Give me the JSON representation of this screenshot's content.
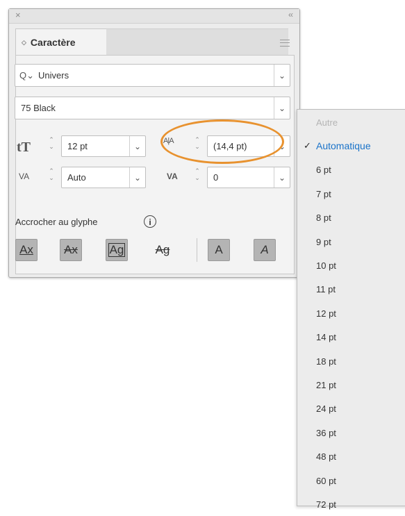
{
  "panel": {
    "close_glyph": "×",
    "collapse_glyph": "‹‹",
    "tab_label": "Caractère",
    "tab_chevron": "◇",
    "font_family": "Univers",
    "font_style": "75 Black",
    "font_size": "12 pt",
    "leading": "(14,4 pt)",
    "kerning": "Auto",
    "tracking": "0",
    "snap_label": "Accrocher au glyphe",
    "info_glyph": "i",
    "search_glyph": "Q⌄",
    "caret_glyph": "⌄"
  },
  "icons": {
    "font_size_icon": "tT",
    "leading_icon": "A|A",
    "kerning_icon": "VA",
    "tracking_icon": "VA"
  },
  "glyph_buttons": [
    {
      "label": "Ax",
      "active": true
    },
    {
      "label": "Ax",
      "active": true
    },
    {
      "label": "Ag",
      "active": true
    },
    {
      "label": "Ag",
      "active": false
    },
    {
      "label": "A",
      "active": true
    },
    {
      "label": "A",
      "active": true
    }
  ],
  "leading_menu": {
    "items": [
      {
        "label": "Autre",
        "state": "disabled"
      },
      {
        "label": "Automatique",
        "state": "selected"
      },
      {
        "label": "6 pt"
      },
      {
        "label": "7 pt"
      },
      {
        "label": "8 pt"
      },
      {
        "label": "9 pt"
      },
      {
        "label": "10 pt"
      },
      {
        "label": "11 pt"
      },
      {
        "label": "12 pt"
      },
      {
        "label": "14 pt"
      },
      {
        "label": "18 pt"
      },
      {
        "label": "21 pt"
      },
      {
        "label": "24 pt"
      },
      {
        "label": "36 pt"
      },
      {
        "label": "48 pt"
      },
      {
        "label": "60 pt"
      },
      {
        "label": "72 pt"
      }
    ],
    "check_glyph": "✓"
  },
  "colors": {
    "highlight": "#e8922f",
    "selected_text": "#1a73c9"
  }
}
